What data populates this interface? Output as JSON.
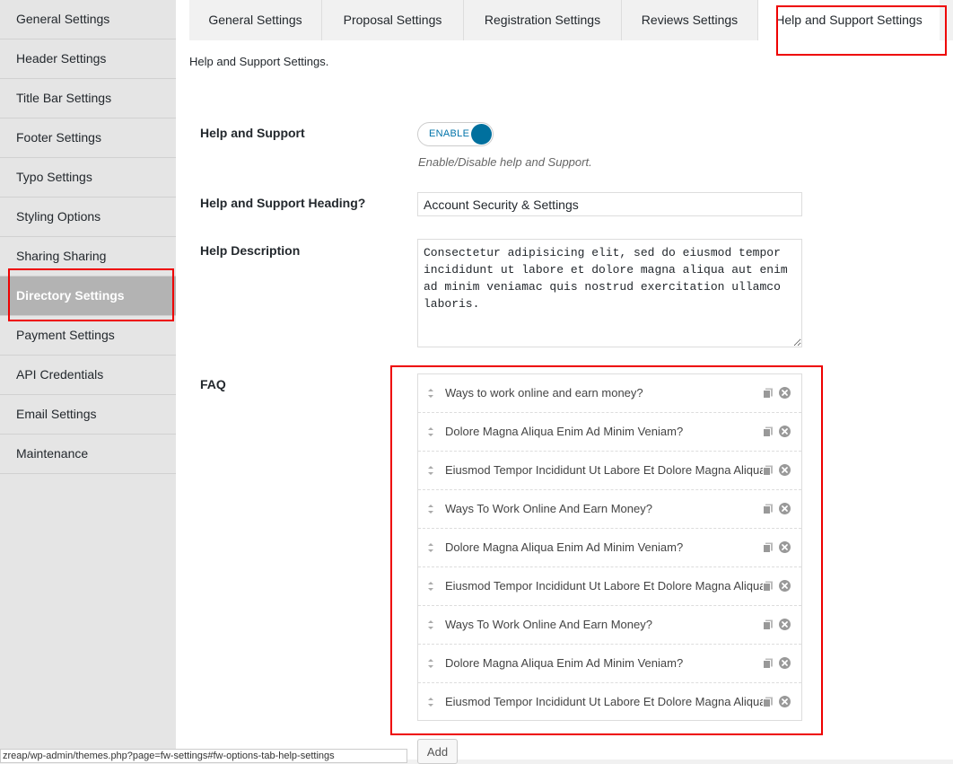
{
  "sidebar": {
    "items": [
      {
        "label": "General Settings"
      },
      {
        "label": "Header Settings"
      },
      {
        "label": "Title Bar Settings"
      },
      {
        "label": "Footer Settings"
      },
      {
        "label": "Typo Settings"
      },
      {
        "label": "Styling Options"
      },
      {
        "label": "Sharing Sharing"
      },
      {
        "label": "Directory Settings"
      },
      {
        "label": "Payment Settings"
      },
      {
        "label": "API Credentials"
      },
      {
        "label": "Email Settings"
      },
      {
        "label": "Maintenance"
      }
    ],
    "active_label": "Directory Settings"
  },
  "tabs": [
    {
      "label": "General Settings"
    },
    {
      "label": "Proposal Settings"
    },
    {
      "label": "Registration Settings"
    },
    {
      "label": "Reviews Settings"
    },
    {
      "label": "Help and Support Settings"
    }
  ],
  "active_tab": "Help and Support Settings",
  "section_description": "Help and Support Settings.",
  "fields": {
    "help_support": {
      "label": "Help and Support",
      "switch_label": "ENABLE",
      "help": "Enable/Disable help and Support."
    },
    "heading": {
      "label": "Help and Support Heading?",
      "value": "Account Security & Settings"
    },
    "description": {
      "label": "Help Description",
      "value": "Consectetur adipisicing elit, sed do eiusmod tempor incididunt ut labore et dolore magna aliqua aut enim ad minim veniamac quis nostrud exercitation ullamco laboris."
    },
    "faq": {
      "label": "FAQ",
      "items": [
        {
          "text": "Ways to work online and earn money?"
        },
        {
          "text": "Dolore Magna Aliqua Enim Ad Minim Veniam?"
        },
        {
          "text": "Eiusmod Tempor Incididunt Ut Labore Et Dolore Magna Aliqua?"
        },
        {
          "text": "Ways To Work Online And Earn Money?"
        },
        {
          "text": "Dolore Magna Aliqua Enim Ad Minim Veniam?"
        },
        {
          "text": "Eiusmod Tempor Incididunt Ut Labore Et Dolore Magna Aliqua?"
        },
        {
          "text": "Ways To Work Online And Earn Money?"
        },
        {
          "text": "Dolore Magna Aliqua Enim Ad Minim Veniam?"
        },
        {
          "text": "Eiusmod Tempor Incididunt Ut Labore Et Dolore Magna Aliqua?"
        }
      ],
      "add_label": "Add",
      "icons": {
        "drag": "drag-handle-icon",
        "copy": "copy-icon",
        "remove": "remove-icon"
      }
    }
  },
  "status_bar": {
    "url": "zreap/wp-admin/themes.php?page=fw-settings#fw-options-tab-help-settings"
  },
  "colors": {
    "highlight": "#e00000",
    "accent": "#00709e",
    "sidebar_bg": "#e5e5e5",
    "sidebar_active_bg": "#b3b3b3"
  }
}
